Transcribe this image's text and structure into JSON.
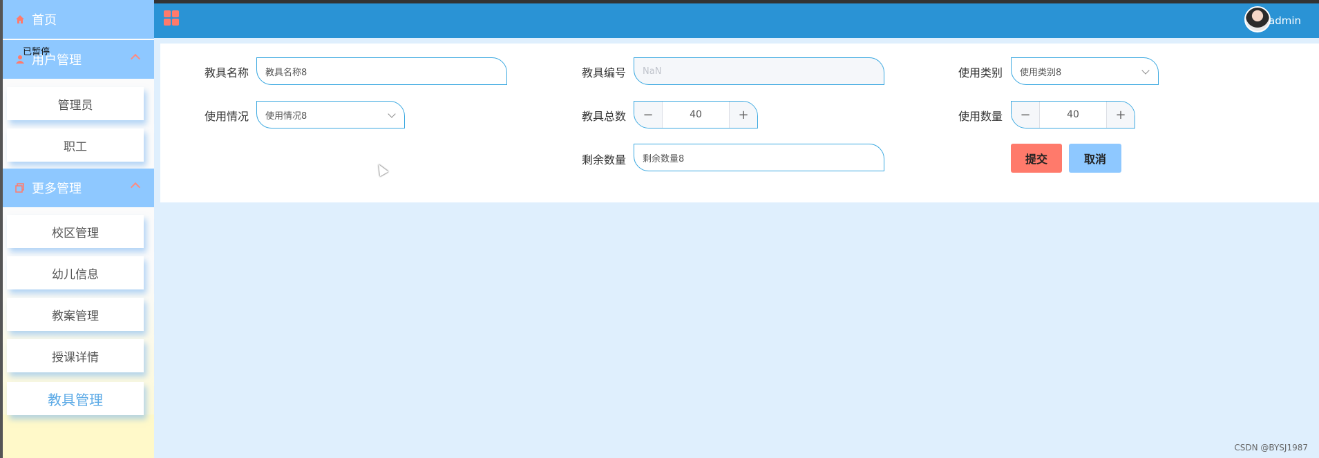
{
  "sidebar": {
    "home_label": "首页",
    "tooltip": "已暂停",
    "groups": [
      {
        "label": "用户管理",
        "icon": "user-icon",
        "items": [
          "管理员",
          "职工"
        ]
      },
      {
        "label": "更多管理",
        "icon": "copy-icon",
        "items": [
          "校区管理",
          "幼儿信息",
          "教案管理",
          "授课详情",
          "教具管理"
        ]
      }
    ],
    "active_item": "教具管理"
  },
  "header": {
    "menu_icon": "grid-icon",
    "user_name": "admin"
  },
  "form": {
    "name_label": "教具名称",
    "name_value": "教具名称8",
    "code_label": "教具编号",
    "code_placeholder": "NaN",
    "category_label": "使用类别",
    "category_value": "使用类别8",
    "usage_label": "使用情况",
    "usage_value": "使用情况8",
    "total_label": "教具总数",
    "total_value": "40",
    "used_label": "使用数量",
    "used_value": "40",
    "remain_label": "剩余数量",
    "remain_value": "剩余数量8",
    "submit_label": "提交",
    "cancel_label": "取消"
  },
  "colors": {
    "header": "#2a93d5",
    "sidebar_group": "#8ec8ff",
    "submit": "#ff7a6b",
    "cancel": "#8ec8ff",
    "page_bg": "#dfeffd"
  },
  "watermark": "CSDN @BYSJ1987"
}
